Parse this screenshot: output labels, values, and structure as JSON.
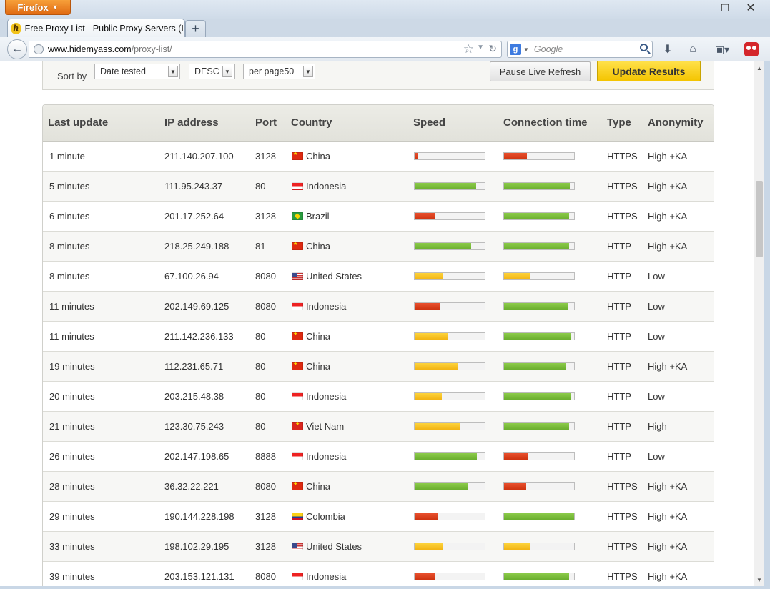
{
  "browser": {
    "app_button": "Firefox",
    "tab_title": "Free Proxy List - Public Proxy Servers (IP ...",
    "favicon_letter": "h",
    "url_host": "www.hidemyass.com",
    "url_path": "/proxy-list/",
    "search_placeholder": "Google"
  },
  "filters": {
    "sort_label": "Sort by",
    "sort_value": "Date tested",
    "order_value": "DESC",
    "per_page_value": "per page50",
    "pause_button": "Pause Live Refresh",
    "update_button": "Update Results"
  },
  "table": {
    "headers": [
      "Last update",
      "IP address",
      "Port",
      "Country",
      "Speed",
      "Connection time",
      "Type",
      "Anonymity"
    ],
    "rows": [
      {
        "last_update": "1 minute",
        "ip": "211.140.207.100",
        "port": "3128",
        "country": "China",
        "flag": "china",
        "speed": 0.04,
        "speed_color": "red",
        "conn": 0.33,
        "conn_color": "red",
        "type": "HTTPS",
        "anonymity": "High +KA"
      },
      {
        "last_update": "5 minutes",
        "ip": "111.95.243.37",
        "port": "80",
        "country": "Indonesia",
        "flag": "indonesia",
        "speed": 0.88,
        "speed_color": "green",
        "conn": 0.94,
        "conn_color": "green",
        "type": "HTTPS",
        "anonymity": "High +KA"
      },
      {
        "last_update": "6 minutes",
        "ip": "201.17.252.64",
        "port": "3128",
        "country": "Brazil",
        "flag": "brazil",
        "speed": 0.3,
        "speed_color": "red",
        "conn": 0.93,
        "conn_color": "green",
        "type": "HTTPS",
        "anonymity": "High +KA"
      },
      {
        "last_update": "8 minutes",
        "ip": "218.25.249.188",
        "port": "81",
        "country": "China",
        "flag": "china",
        "speed": 0.81,
        "speed_color": "green",
        "conn": 0.93,
        "conn_color": "green",
        "type": "HTTP",
        "anonymity": "High +KA"
      },
      {
        "last_update": "8 minutes",
        "ip": "67.100.26.94",
        "port": "8080",
        "country": "United States",
        "flag": "us",
        "speed": 0.41,
        "speed_color": "yellow",
        "conn": 0.37,
        "conn_color": "yellow",
        "type": "HTTP",
        "anonymity": "Low"
      },
      {
        "last_update": "11 minutes",
        "ip": "202.149.69.125",
        "port": "8080",
        "country": "Indonesia",
        "flag": "indonesia",
        "speed": 0.36,
        "speed_color": "red",
        "conn": 0.92,
        "conn_color": "green",
        "type": "HTTP",
        "anonymity": "Low"
      },
      {
        "last_update": "11 minutes",
        "ip": "211.142.236.133",
        "port": "80",
        "country": "China",
        "flag": "china",
        "speed": 0.48,
        "speed_color": "yellow",
        "conn": 0.95,
        "conn_color": "green",
        "type": "HTTP",
        "anonymity": "Low"
      },
      {
        "last_update": "19 minutes",
        "ip": "112.231.65.71",
        "port": "80",
        "country": "China",
        "flag": "china",
        "speed": 0.62,
        "speed_color": "yellow",
        "conn": 0.88,
        "conn_color": "green",
        "type": "HTTP",
        "anonymity": "High +KA"
      },
      {
        "last_update": "20 minutes",
        "ip": "203.215.48.38",
        "port": "80",
        "country": "Indonesia",
        "flag": "indonesia",
        "speed": 0.39,
        "speed_color": "yellow",
        "conn": 0.96,
        "conn_color": "green",
        "type": "HTTP",
        "anonymity": "Low"
      },
      {
        "last_update": "21 minutes",
        "ip": "123.30.75.243",
        "port": "80",
        "country": "Viet Nam",
        "flag": "vietnam",
        "speed": 0.65,
        "speed_color": "yellow",
        "conn": 0.93,
        "conn_color": "green",
        "type": "HTTP",
        "anonymity": "High"
      },
      {
        "last_update": "26 minutes",
        "ip": "202.147.198.65",
        "port": "8888",
        "country": "Indonesia",
        "flag": "indonesia",
        "speed": 0.89,
        "speed_color": "green",
        "conn": 0.34,
        "conn_color": "red",
        "type": "HTTP",
        "anonymity": "Low"
      },
      {
        "last_update": "28 minutes",
        "ip": "36.32.22.221",
        "port": "8080",
        "country": "China",
        "flag": "china",
        "speed": 0.77,
        "speed_color": "green",
        "conn": 0.32,
        "conn_color": "red",
        "type": "HTTPS",
        "anonymity": "High +KA"
      },
      {
        "last_update": "29 minutes",
        "ip": "190.144.228.198",
        "port": "3128",
        "country": "Colombia",
        "flag": "colombia",
        "speed": 0.34,
        "speed_color": "red",
        "conn": 1.0,
        "conn_color": "green",
        "type": "HTTPS",
        "anonymity": "High +KA"
      },
      {
        "last_update": "33 minutes",
        "ip": "198.102.29.195",
        "port": "3128",
        "country": "United States",
        "flag": "us",
        "speed": 0.41,
        "speed_color": "yellow",
        "conn": 0.37,
        "conn_color": "yellow",
        "type": "HTTPS",
        "anonymity": "High +KA"
      },
      {
        "last_update": "39 minutes",
        "ip": "203.153.121.131",
        "port": "8080",
        "country": "Indonesia",
        "flag": "indonesia",
        "speed": 0.3,
        "speed_color": "red",
        "conn": 0.93,
        "conn_color": "green",
        "type": "HTTPS",
        "anonymity": "High +KA"
      }
    ]
  }
}
